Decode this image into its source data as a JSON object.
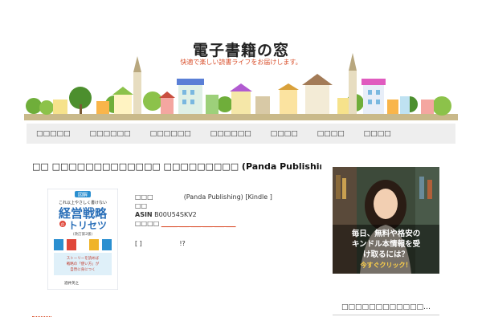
{
  "site": {
    "title": "電子書籍の窓",
    "tagline": "快適で楽しい読書ライフをお届けします。"
  },
  "nav": {
    "items": [
      "□□□□□",
      "□□□□□□",
      "□□□□□□",
      "□□□□□□",
      "□□□□",
      "□□□□",
      "□□□□"
    ]
  },
  "post": {
    "title": "□□ □□□□□□□□□□□□□ □□□□□□□□□ (Panda Publishing) [Kindle□]",
    "author_label": "□□□",
    "publisher": "(Panda Publishing) [Kindle ]",
    "format_label": "□□",
    "asin_label": "ASIN",
    "asin": "B00U54SKV2",
    "rating_label": "□□□□",
    "rating_value": "_____ ___ ___ ___ ___ ___",
    "extra_left": "[ ]",
    "extra_right": "!?"
  },
  "book": {
    "badge": "図解",
    "line1": "これ以上やさしく書けない",
    "title_main": "経営戦略",
    "title_sub": "の",
    "title_end": "トリセツ",
    "edition": "(改訂第2版)",
    "body1": "ストーリーを読めば",
    "body2": "戦略の「使い方」が",
    "body3": "自然に身につく",
    "author": "酒井英之"
  },
  "sidebar": {
    "ad_line1": "毎日、無料や格安の",
    "ad_line2": "キンドル本情報を受",
    "ad_line3": "け取るには？",
    "ad_cta": "今すぐクリック！",
    "heading": "□□□□□□□□□□□□…"
  },
  "colors": {
    "accent": "#d94f2b",
    "nav_bg": "#eeeeee",
    "ad_cta": "#ffd24a"
  }
}
